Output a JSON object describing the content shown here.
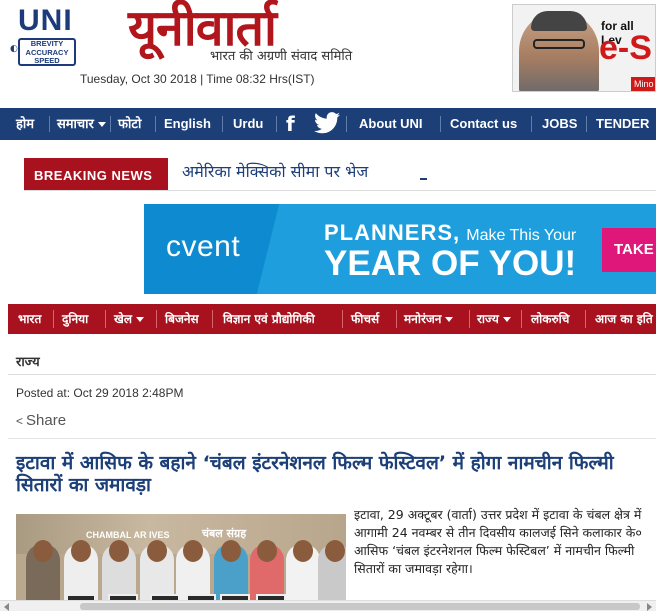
{
  "header": {
    "uni_logo": {
      "name": "UNI",
      "line1": "BREVITY",
      "line2": "ACCURACY",
      "line3": "SPEED"
    },
    "hindi_logo": {
      "title": "यूनीवार्ता",
      "tagline": "भारत की अग्रणी संवाद समिति"
    },
    "date_line": "Tuesday, Oct 30 2018 | Time 08:32 Hrs(IST)",
    "ad_top": {
      "line1": "for all Lev",
      "line2": "e-S",
      "line3": "Mino"
    }
  },
  "main_nav": {
    "items": [
      "होम",
      "समाचार",
      "फोटो",
      "English",
      "Urdu",
      "About UNI",
      "Contact us",
      "JOBS",
      "TENDER"
    ],
    "facebook_icon": "f"
  },
  "breaking": {
    "label": "BREAKING NEWS",
    "ticker": "अमेरिका मेक्सिको सीमा पर भेज"
  },
  "banner": {
    "logo": "cvent",
    "line1_bold": "PLANNERS,",
    "line1_rest": "Make This Your",
    "line2": "YEAR OF YOU!",
    "cta": "TAKE"
  },
  "sec_nav": {
    "items": [
      "भारत",
      "दुनिया",
      "खेल",
      "बिजनेस",
      "विज्ञान एवं प्रौद्योगिकी",
      "फीचर्स",
      "मनोरंजन",
      "राज्य",
      "लोकरुचि",
      "आज का इति"
    ]
  },
  "article": {
    "section": "राज्य",
    "posted": "Posted at: Oct 29 2018 2:48PM",
    "share": "Share",
    "headline": "इटावा में आसिफ के बहाने ‘चंबल इंटरनेशनल फिल्म फेस्टिवल’ में होगा नामचीन फिल्मी सितारों का जमावड़ा",
    "photo_text1": "CHAMBAL AR   IVES",
    "photo_text2": "चंबल संग्रह",
    "body": "इटावा, 29 अक्टूबर (वार्ता) उत्तर प्रदेश में इटावा के चंबल क्षेत्र में आगामी 24 नवम्बर से तीन दिवसीय कालजई सिने कलाकार के० आसिफ ‘चंबल इंटरनेशनल फिल्म फेस्टिबल’ में नामचीन फिल्मी सितारों का जमावड़ा रहेगा।"
  },
  "colors": {
    "nav_blue": "#1c3f78",
    "brand_red": "#a8121f",
    "logo_red": "#b0161c",
    "banner_blue": "#1f9ede",
    "cta_pink": "#e0177a"
  }
}
